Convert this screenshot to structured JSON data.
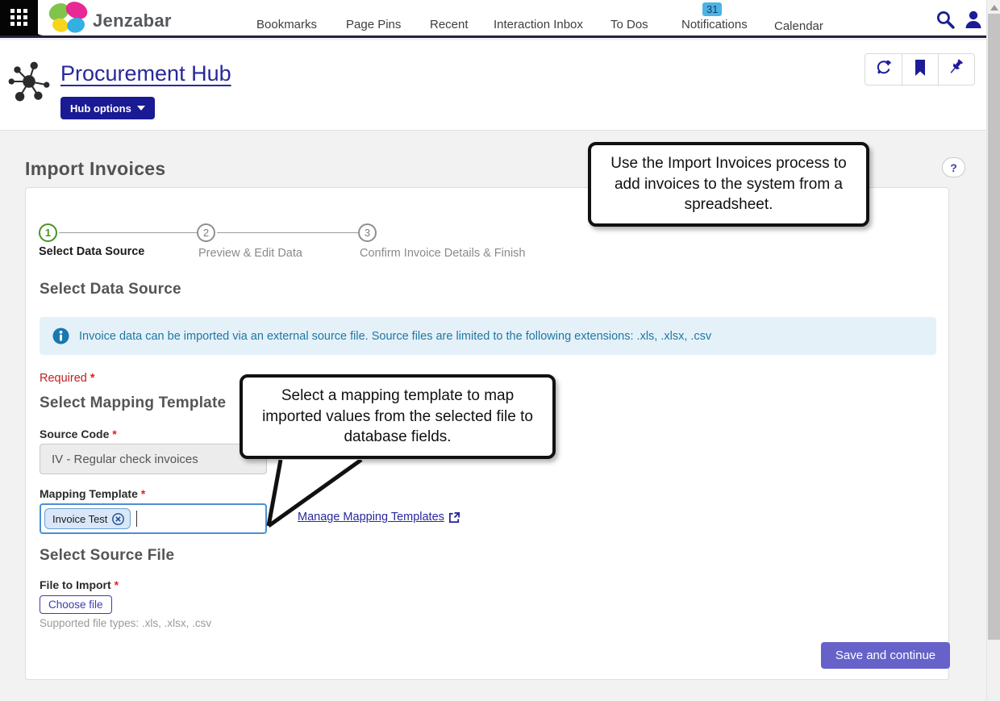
{
  "nav": {
    "brand": "Jenzabar",
    "items": [
      "Bookmarks",
      "Page Pins",
      "Recent",
      "Interaction Inbox",
      "To Dos",
      "Notifications",
      "Calendar"
    ],
    "notifications_count": "31"
  },
  "header": {
    "title": "Procurement Hub",
    "hub_options_label": "Hub options"
  },
  "page": {
    "title": "Import Invoices",
    "help_label": "?"
  },
  "wizard": {
    "steps": [
      {
        "number": "1",
        "label": "Select Data Source"
      },
      {
        "number": "2",
        "label": "Preview & Edit Data"
      },
      {
        "number": "3",
        "label": "Confirm Invoice Details & Finish"
      }
    ]
  },
  "form": {
    "section_title": "Select Data Source",
    "info_message": "Invoice data can be imported via an external source file. Source files are limited to the following extensions: .xls, .xlsx, .csv",
    "required_label": "Required",
    "required_star": "*",
    "mapping_section_title": "Select Mapping Template",
    "source_code_label": "Source Code",
    "source_code_value": "IV - Regular check invoices",
    "mapping_template_label": "Mapping Template",
    "mapping_template_chip": "Invoice Test",
    "manage_link_label": "Manage Mapping Templates",
    "source_file_section_title": "Select Source File",
    "file_label": "File to Import",
    "choose_file_label": "Choose file",
    "supported_text": "Supported file types: .xls, .xlsx, .csv",
    "save_button_label": "Save and continue"
  },
  "tooltips": {
    "import_invoices": "Use the Import Invoices process to add invoices to the system from a spreadsheet.",
    "mapping_template": "Select a mapping template to map imported values from the selected file to database fields."
  },
  "icons": {
    "app-launcher-icon": "3x3 grid",
    "butterfly-logo": "multicolor butterfly",
    "search-icon": "magnifier",
    "user-icon": "person silhouette",
    "hub-network-icon": "connected nodes",
    "sync-add-icon": "circular arrow with plus",
    "bookmark-icon": "filled bookmark",
    "pin-icon": "pushpin",
    "info-icon": "info circle",
    "external-link-icon": "box with arrow",
    "chip-remove-icon": "circled x",
    "caret-down-icon": "triangle down"
  },
  "colors": {
    "accent_blue": "#28289c",
    "save_purple": "#6662ca",
    "badge_blue": "#4cb3e6",
    "info_bg": "#e4f1f9",
    "info_text": "#2177a3",
    "step_active_green": "#4a9427",
    "required_red": "#bf2020",
    "nav_border": "#23233b"
  }
}
